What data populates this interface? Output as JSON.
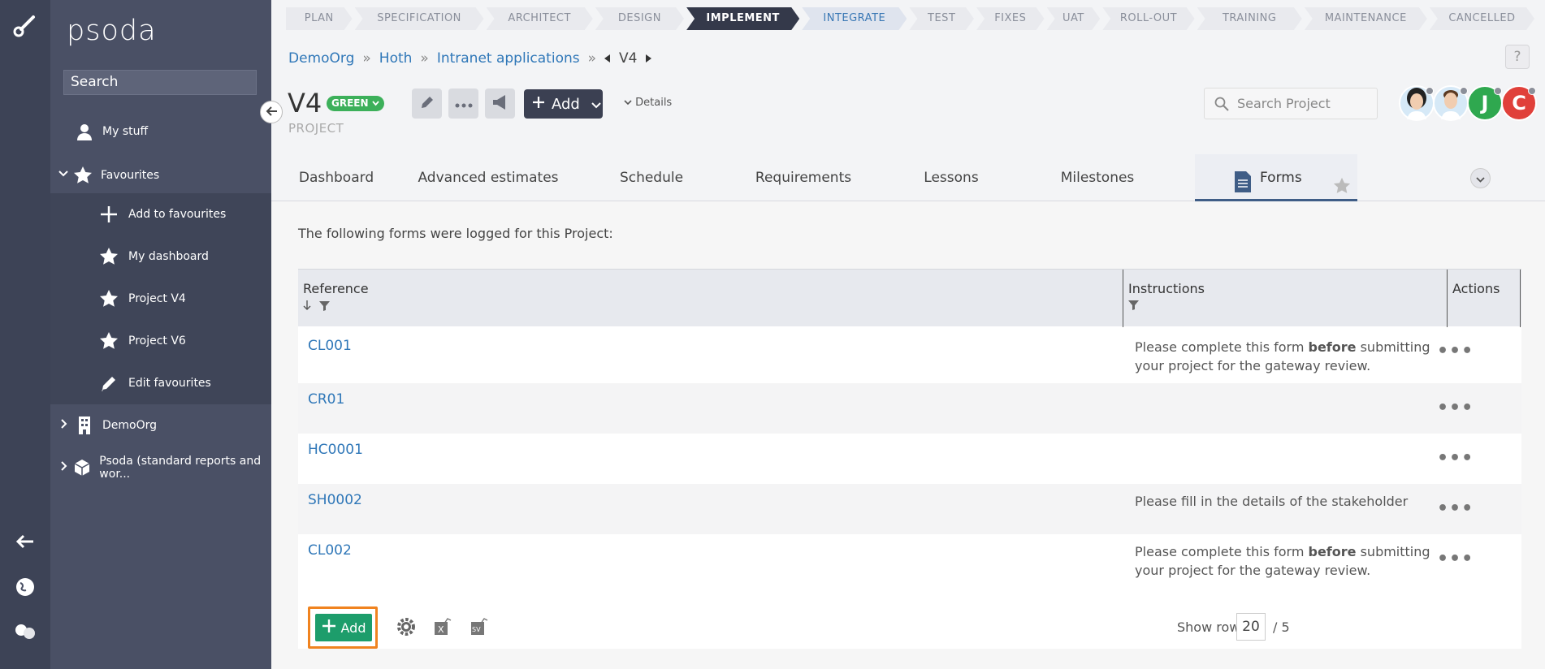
{
  "brand": {
    "name": "psoda"
  },
  "sidebar": {
    "search_placeholder": "Search",
    "items": [
      {
        "label": "My stuff"
      },
      {
        "label": "Favourites"
      },
      {
        "label": "Add to favourites"
      },
      {
        "label": "My dashboard"
      },
      {
        "label": "Project V4"
      },
      {
        "label": "Project V6"
      },
      {
        "label": "Edit favourites"
      },
      {
        "label": "DemoOrg"
      },
      {
        "label": "Psoda (standard reports and wor..."
      }
    ]
  },
  "stages": [
    {
      "label": "PLAN"
    },
    {
      "label": "SPECIFICATION"
    },
    {
      "label": "ARCHITECT"
    },
    {
      "label": "DESIGN"
    },
    {
      "label": "IMPLEMENT"
    },
    {
      "label": "INTEGRATE"
    },
    {
      "label": "TEST"
    },
    {
      "label": "FIXES"
    },
    {
      "label": "UAT"
    },
    {
      "label": "ROLL-OUT"
    },
    {
      "label": "TRAINING"
    },
    {
      "label": "MAINTENANCE"
    },
    {
      "label": "CANCELLED"
    }
  ],
  "breadcrumb": {
    "items": [
      "DemoOrg",
      "Hoth",
      "Intranet applications"
    ],
    "separator": "»",
    "current": "V4"
  },
  "help_label": "?",
  "header": {
    "title": "V4",
    "status": "GREEN",
    "subtitle": "PROJECT",
    "add_label": "Add",
    "details_label": "Details",
    "search_placeholder": "Search Project"
  },
  "avatars": [
    {
      "initial": "",
      "color": "#cfe3f1"
    },
    {
      "initial": "",
      "color": "#cfe3f1"
    },
    {
      "initial": "J",
      "color": "#2fa84f"
    },
    {
      "initial": "C",
      "color": "#e0403a"
    }
  ],
  "tabs": [
    {
      "label": "Dashboard"
    },
    {
      "label": "Advanced estimates"
    },
    {
      "label": "Schedule"
    },
    {
      "label": "Requirements"
    },
    {
      "label": "Lessons"
    },
    {
      "label": "Milestones"
    },
    {
      "label": "Forms"
    }
  ],
  "content": {
    "intro": "The following forms were logged for this Project:",
    "columns": {
      "reference": "Reference",
      "instructions": "Instructions",
      "actions": "Actions"
    },
    "rows": [
      {
        "ref": "CL001",
        "instr_pre": "Please complete this form ",
        "instr_bold": "before",
        "instr_post": " submitting your project for the gateway review."
      },
      {
        "ref": "CR01",
        "instr_pre": "",
        "instr_bold": "",
        "instr_post": ""
      },
      {
        "ref": "HC0001",
        "instr_pre": "",
        "instr_bold": "",
        "instr_post": ""
      },
      {
        "ref": "SH0002",
        "instr_pre": "Please fill in the details of the stakeholder",
        "instr_bold": "",
        "instr_post": ""
      },
      {
        "ref": "CL002",
        "instr_pre": "Please complete this form ",
        "instr_bold": "before",
        "instr_post": " submitting your project for the gateway review."
      }
    ],
    "more_label": "•••",
    "add_label": "Add",
    "show_rows_label": "Show rows:",
    "show_rows_value": "20",
    "total_label": "/ 5"
  },
  "colors": {
    "accent": "#3b4052",
    "link": "#2f77b8",
    "add_green": "#1d9d6b",
    "highlight": "#f0831f"
  }
}
